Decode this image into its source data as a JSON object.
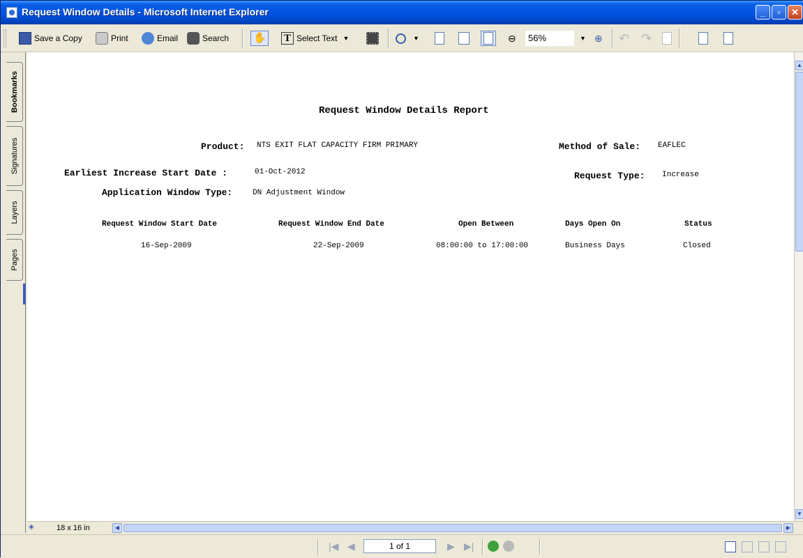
{
  "window": {
    "title": "Request Window Details - Microsoft Internet Explorer"
  },
  "toolbar": {
    "save_copy": "Save a Copy",
    "print": "Print",
    "email": "Email",
    "search": "Search",
    "select_text": "Select Text",
    "zoom": "56%"
  },
  "nav_tabs": {
    "bookmarks": "Bookmarks",
    "signatures": "Signatures",
    "layers": "Layers",
    "pages": "Pages"
  },
  "report": {
    "title": "Request Window Details Report",
    "product_label": "Product:",
    "product_value": "NTS EXIT FLAT CAPACITY FIRM PRIMARY",
    "method_label": "Method of Sale:",
    "method_value": "EAFLEC",
    "earliest_label": "Earliest Increase Start Date :",
    "earliest_value": "01-Oct-2012",
    "request_type_label": "Request Type:",
    "request_type_value": "Increase",
    "app_window_label": "Application Window Type:",
    "app_window_value": "DN Adjustment Window",
    "columns": [
      "Request Window Start Date",
      "Request Window End Date",
      "Open Between",
      "Days Open On",
      "Status"
    ],
    "rows": [
      [
        "16-Sep-2009",
        "22-Sep-2009",
        "08:00:00 to 17:00:00",
        "Business Days",
        "Closed"
      ]
    ]
  },
  "bottom": {
    "page_size": "18 x 16 in",
    "page_indicator": "1 of 1"
  }
}
